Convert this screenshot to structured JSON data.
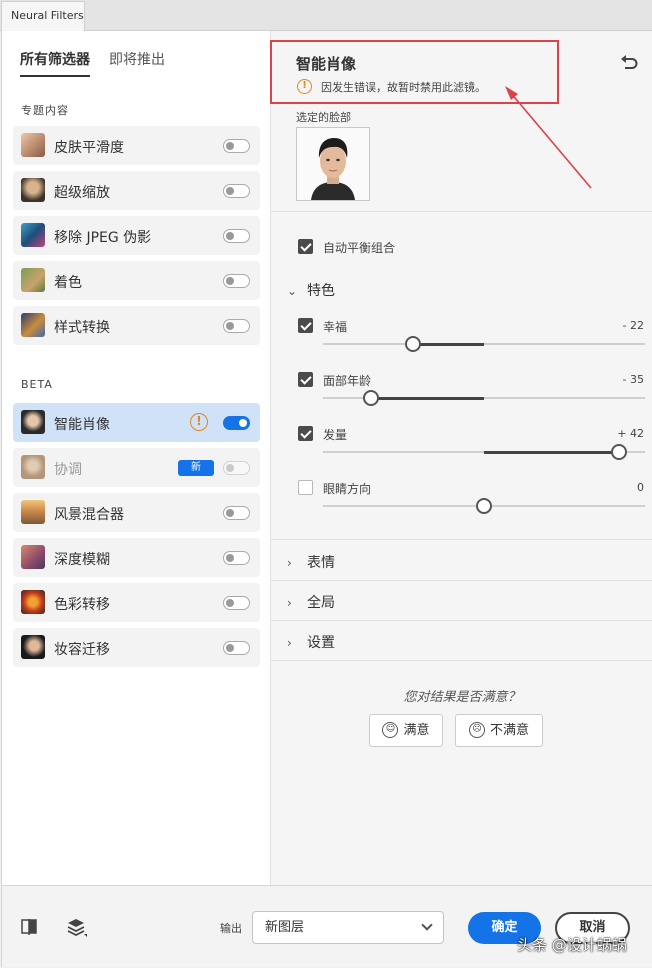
{
  "window": {
    "tab_title": "Neural Filters"
  },
  "left": {
    "tabs": [
      {
        "label": "所有筛选器",
        "active": true
      },
      {
        "label": "即将推出",
        "active": false
      }
    ],
    "featured_label": "专题内容",
    "featured": [
      {
        "label": "皮肤平滑度",
        "on": false
      },
      {
        "label": "超级缩放",
        "on": false
      },
      {
        "label": "移除 JPEG 伪影",
        "on": false
      },
      {
        "label": "着色",
        "on": false
      },
      {
        "label": "样式转换",
        "on": false
      }
    ],
    "beta_label": "BETA",
    "beta": [
      {
        "label": "智能肖像",
        "on": true,
        "warning": true,
        "selected": true
      },
      {
        "label": "协调",
        "on": false,
        "badge": "新",
        "disabled": true
      },
      {
        "label": "风景混合器",
        "on": false
      },
      {
        "label": "深度模糊",
        "on": false
      },
      {
        "label": "色彩转移",
        "on": false
      },
      {
        "label": "妆容迁移",
        "on": false
      }
    ]
  },
  "right": {
    "title": "智能肖像",
    "error_message": "因发生错误，故暂时禁用此滤镜。",
    "selected_face_label": "选定的脸部",
    "auto_balance_label": "自动平衡组合",
    "auto_balance_checked": true,
    "featured_group": "特色",
    "sliders": [
      {
        "label": "幸福",
        "checked": true,
        "value_text": "- 22",
        "value": -22
      },
      {
        "label": "面部年龄",
        "checked": true,
        "value_text": "- 35",
        "value": -35
      },
      {
        "label": "发量",
        "checked": true,
        "value_text": "+ 42",
        "value": 42
      },
      {
        "label": "眼睛方向",
        "checked": false,
        "value_text": "0",
        "value": 0
      }
    ],
    "collapsed_groups": [
      "表情",
      "全局",
      "设置"
    ],
    "feedback_question": "您对结果是否满意？",
    "satisfied_label": "满意",
    "unsatisfied_label": "不满意"
  },
  "bottom": {
    "output_label": "输出",
    "output_value": "新图层",
    "ok_label": "确定",
    "cancel_label": "取消"
  },
  "watermark": "头条 @设计蜗蜗",
  "colors": {
    "accent": "#1473e6",
    "warning": "#e68619",
    "annotation": "#d9434b",
    "selected_row": "#cfe2f8"
  }
}
